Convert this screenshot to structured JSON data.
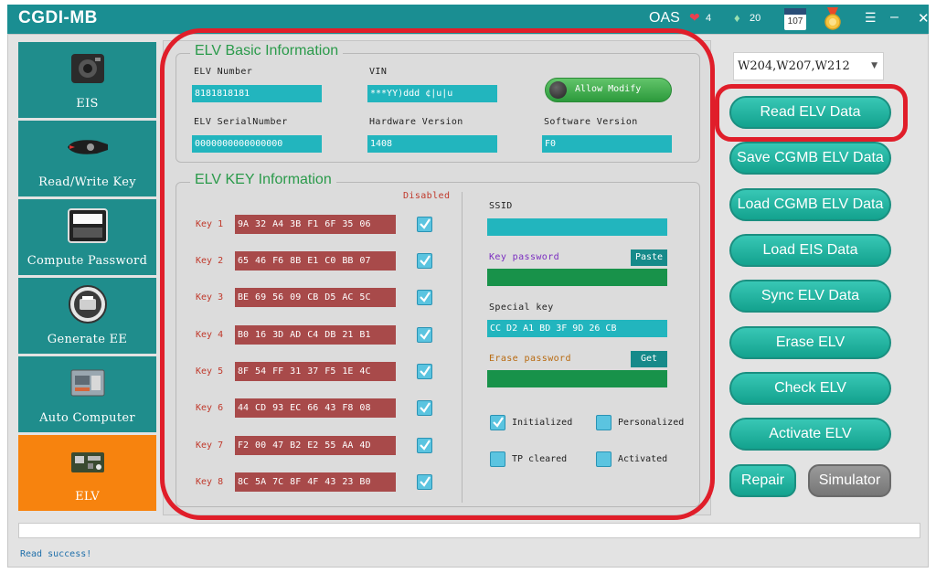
{
  "titlebar": {
    "title": "CGDI-MB",
    "account": "OAS",
    "heart_count": "4",
    "gem_count": "20",
    "calendar_day": "107"
  },
  "sidebar": {
    "items": [
      {
        "label": "EIS",
        "icon": "eis-icon",
        "active": false
      },
      {
        "label": "Read/Write Key",
        "icon": "key-icon",
        "active": false
      },
      {
        "label": "Compute Password",
        "icon": "keyboard-icon",
        "active": false
      },
      {
        "label": "Generate EE",
        "icon": "printer-icon",
        "active": false
      },
      {
        "label": "Auto Computer",
        "icon": "ecu-icon",
        "active": false
      },
      {
        "label": "ELV",
        "icon": "elv-board-icon",
        "active": true
      }
    ]
  },
  "basic_info": {
    "title": "ELV Basic Information",
    "elv_number_label": "ELV Number",
    "elv_number": "8181818181",
    "vin_label": "VIN",
    "vin": "***YY)ddd ¢|u|u",
    "allow_modify": "Allow Modify",
    "serial_label": "ELV SerialNumber",
    "serial": "0000000000000000",
    "hw_label": "Hardware Version",
    "hw": "1408",
    "sw_label": "Software Version",
    "sw": "F0"
  },
  "key_info": {
    "title": "ELV KEY Information",
    "disabled_label": "Disabled",
    "keys": [
      {
        "label": "Key 1",
        "value": "9A 32 A4 3B F1 6F 35 06",
        "disabled": true
      },
      {
        "label": "Key 2",
        "value": "65 46 F6 8B E1 C0 BB 07",
        "disabled": true
      },
      {
        "label": "Key 3",
        "value": "BE 69 56 09 CB D5 AC 5C",
        "disabled": true
      },
      {
        "label": "Key 4",
        "value": "B0 16 3D AD C4 DB 21 B1",
        "disabled": true
      },
      {
        "label": "Key 5",
        "value": "8F 54 FF 31 37 F5 1E 4C",
        "disabled": true
      },
      {
        "label": "Key 6",
        "value": "44 CD 93 EC 66 43 F8 08",
        "disabled": true
      },
      {
        "label": "Key 7",
        "value": "F2 00 47 B2 E2 55 AA 4D",
        "disabled": true
      },
      {
        "label": "Key 8",
        "value": "8C 5A 7C 8F 4F 43 23 B0",
        "disabled": true
      }
    ],
    "ssid_label": "SSID",
    "ssid": "",
    "key_password_label": "Key password",
    "paste_label": "Paste",
    "key_password": "",
    "special_key_label": "Special key",
    "special_key": "CC D2 A1 BD 3F 9D 26 CB",
    "erase_password_label": "Erase password",
    "get_label": "Get",
    "erase_password": "",
    "status": {
      "initialized": {
        "label": "Initialized",
        "checked": true
      },
      "personalized": {
        "label": "Personalized",
        "checked": false
      },
      "tp_cleared": {
        "label": "TP cleared",
        "checked": false
      },
      "activated": {
        "label": "Activated",
        "checked": false
      }
    }
  },
  "right_panel": {
    "model_select": "W204,W207,W212",
    "buttons": [
      {
        "label": "Read  ELV Data"
      },
      {
        "label": "Save CGMB ELV Data"
      },
      {
        "label": "Load CGMB ELV Data"
      },
      {
        "label": "Load EIS Data"
      },
      {
        "label": "Sync ELV Data"
      },
      {
        "label": "Erase ELV"
      },
      {
        "label": "Check ELV"
      },
      {
        "label": "Activate ELV"
      }
    ],
    "repair": "Repair",
    "simulator": "Simulator"
  },
  "footer": {
    "status": "Read success!"
  },
  "colors": {
    "title_bar": "#1a8e92",
    "sidebar": "#1f8d8c",
    "sidebar_active": "#f7830e",
    "field": "#22b5be",
    "key_field": "#a84a4a",
    "highlight": "#e01e2a"
  }
}
